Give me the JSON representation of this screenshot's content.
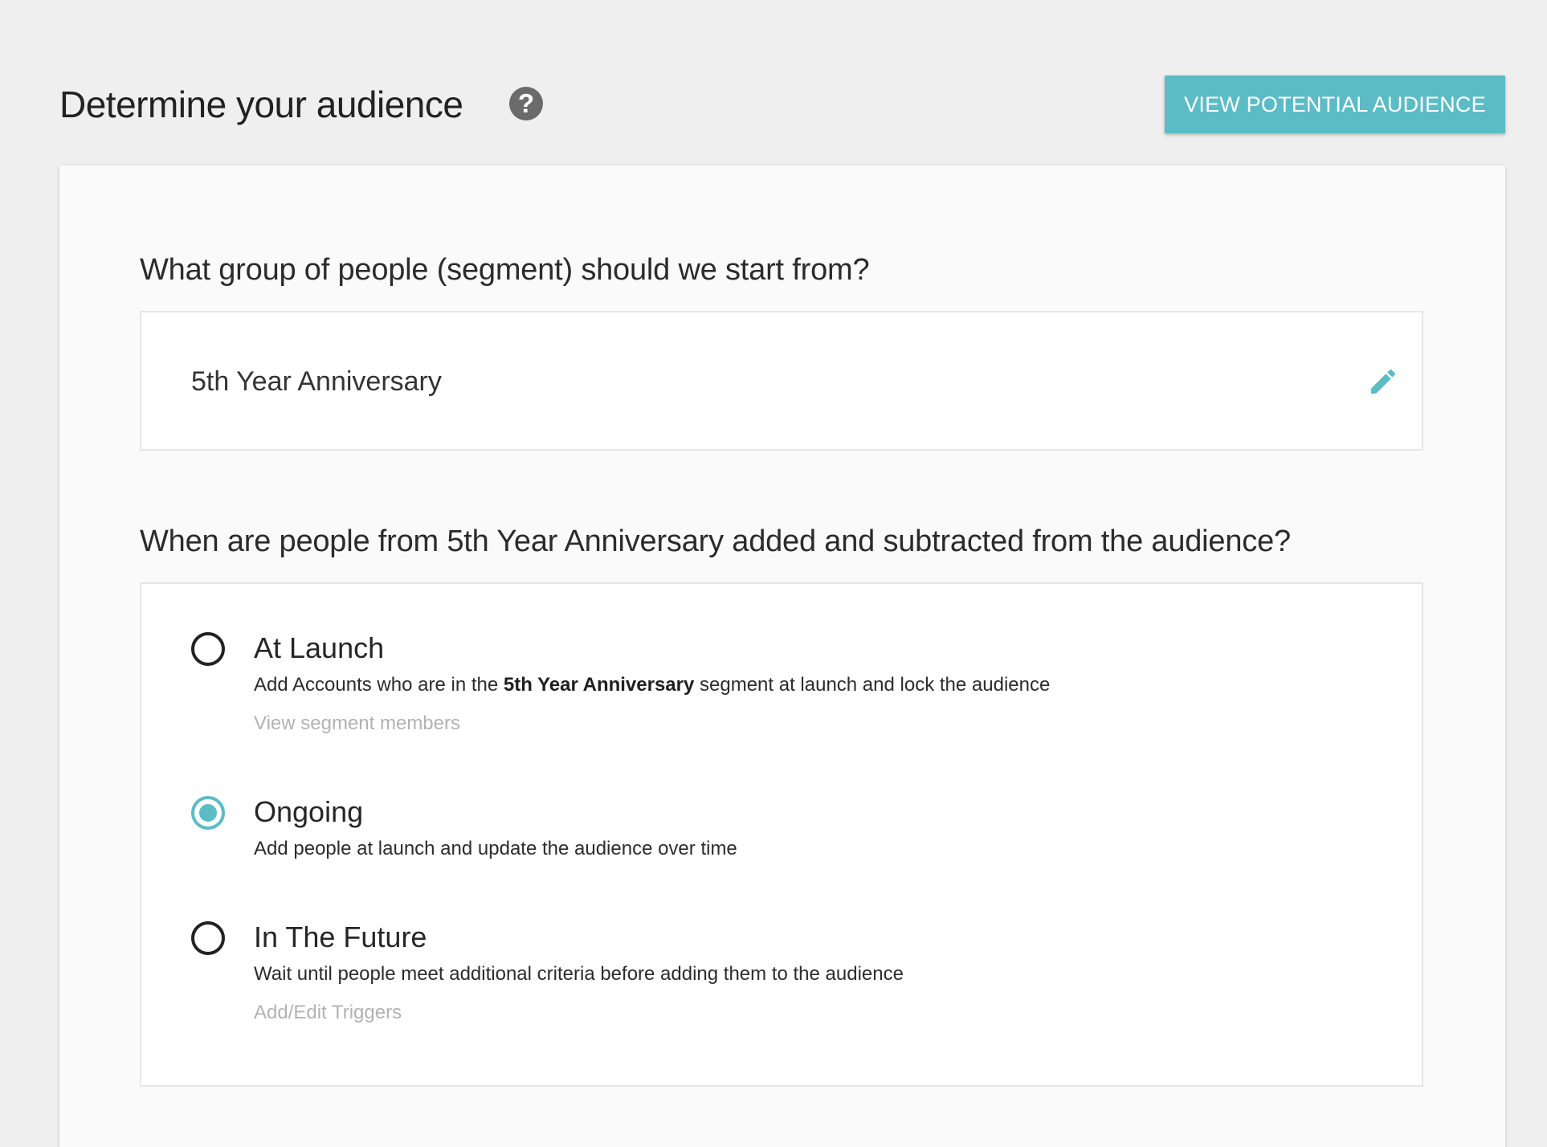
{
  "header": {
    "title": "Determine your audience",
    "help_icon_glyph": "?",
    "view_button_label": "VIEW POTENTIAL AUDIENCE"
  },
  "segment_section": {
    "question": "What group of people (segment) should we start from?",
    "selected_segment": "5th Year Anniversary",
    "edit_icon": "pencil-icon"
  },
  "timing_section": {
    "question": "When are people from 5th Year Anniversary added and subtracted from the audience?",
    "options": [
      {
        "label": "At Launch",
        "desc_prefix": "Add Accounts who are in the ",
        "desc_bold": "5th Year Anniversary",
        "desc_suffix": " segment at launch and lock the audience",
        "link": "View segment members",
        "selected": false
      },
      {
        "label": "Ongoing",
        "desc": "Add people at launch and update the audience over time",
        "selected": true
      },
      {
        "label": "In The Future",
        "desc": "Wait until people meet additional criteria before adding them to the audience",
        "link": "Add/Edit Triggers",
        "selected": false
      }
    ]
  },
  "colors": {
    "accent": "#5cbcc6",
    "background": "#efefef",
    "card": "#fafafa",
    "muted_link": "#b2b2b2"
  }
}
